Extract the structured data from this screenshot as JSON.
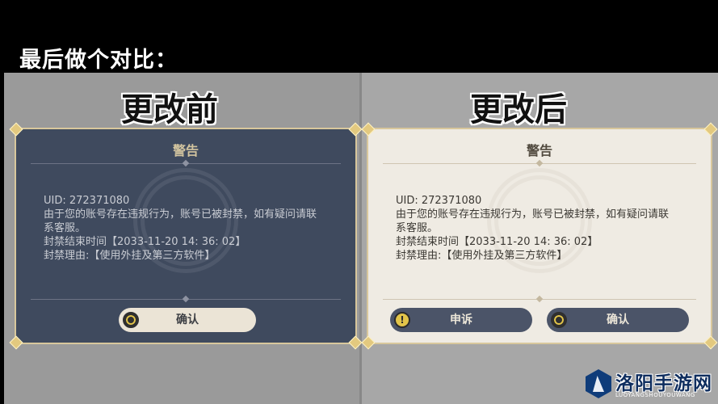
{
  "header": {
    "title": "最后做个对比："
  },
  "before": {
    "label": "更改前",
    "dialog": {
      "title": "警告",
      "uid_line": "UID: 272371080",
      "message_line1": "由于您的账号存在违规行为，账号已被封禁，如有疑问请联",
      "message_line2": "系客服。",
      "ban_end": "封禁结束时间【2033-11-20 14: 36: 02】",
      "ban_reason": "封禁理由:【使用外挂及第三方软件】",
      "confirm_label": "确认"
    }
  },
  "after": {
    "label": "更改后",
    "dialog": {
      "title": "警告",
      "uid_line": "UID: 272371080",
      "message_line1": "由于您的账号存在违规行为，账号已被封禁，如有疑问请联",
      "message_line2": "系客服。",
      "ban_end": "封禁结束时间【2033-11-20 14: 36: 02】",
      "ban_reason": "封禁理由:【使用外挂及第三方软件】",
      "appeal_label": "申诉",
      "confirm_label": "确认"
    }
  },
  "watermark": {
    "text": "洛阳手游网",
    "subtext": "LUOYANGSHOUYOUWANG"
  },
  "colors": {
    "dark_dialog": "#3f4a5e",
    "light_dialog": "#efebe3",
    "gold_border": "#d8c79c",
    "button_dark": "#4b5468",
    "button_light": "#ebe4d6"
  }
}
